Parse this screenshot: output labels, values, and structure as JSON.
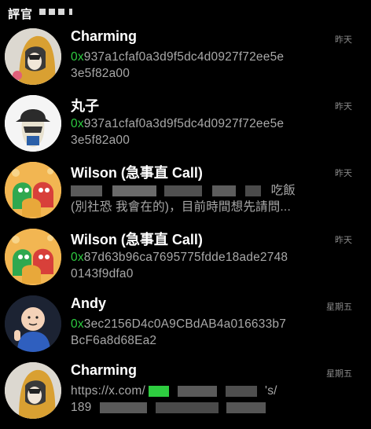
{
  "header": {
    "title": "評官"
  },
  "chats": [
    {
      "name": "Charming",
      "time": "昨天",
      "preview_prefix": "0x",
      "preview_line1": "937a1cfaf0a3d9f5dc4d0927f72ee5e",
      "preview_line2": "3e5f82a00",
      "avatar": "hooded-figure-avatar"
    },
    {
      "name": "丸子",
      "time": "昨天",
      "preview_prefix": "0x",
      "preview_line1": "937a1cfaf0a3d9f5dc4d0927f72ee5e",
      "preview_line2": "3e5f82a00",
      "avatar": "bucket-hat-character-avatar"
    },
    {
      "name": "Wilson (急事直 Call)",
      "time": "昨天",
      "preview_line1_end": "吃飯",
      "preview_line2": "(別社恐 我會在的)，目前時間想先請問...",
      "avatar": "monster-sticker-avatar"
    },
    {
      "name": "Wilson (急事直 Call)",
      "time": "昨天",
      "preview_prefix": "0x",
      "preview_line1": "87d63b96ca7695775fdde18ade2748",
      "preview_line2": "0143f9dfa0",
      "avatar": "monster-sticker-avatar"
    },
    {
      "name": "Andy",
      "time": "星期五",
      "preview_prefix": "0x",
      "preview_line1": "3ec2156D4c0A9CBdAB4a016633b7",
      "preview_line2": "BcF6a8d68Ea2",
      "avatar": "cartoon-man-avatar"
    },
    {
      "name": "Charming",
      "time": "星期五",
      "preview_line1": "https://x.com/",
      "preview_line1_end": "'s/",
      "preview_line2": "189",
      "avatar": "hooded-figure-avatar"
    }
  ],
  "colors": {
    "background": "#000000",
    "hex_prefix": "#2ecc40",
    "preview_text": "#a8a8a8",
    "timestamp": "#8a8a8a"
  }
}
